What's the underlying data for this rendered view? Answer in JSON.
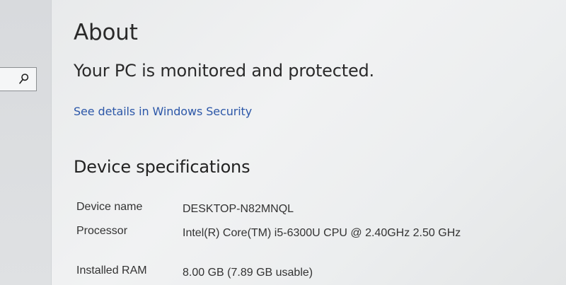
{
  "page": {
    "title": "About",
    "protection_status": "Your PC is monitored and protected.",
    "security_link": "See details in Windows Security"
  },
  "device_specifications": {
    "heading": "Device specifications",
    "rows": [
      {
        "label": "Device name",
        "value": "DESKTOP-N82MNQL"
      },
      {
        "label": "Processor",
        "value": "Intel(R) Core(TM) i5-6300U CPU @ 2.40GHz   2.50 GHz"
      },
      {
        "label": "Installed RAM",
        "value": "8.00 GB (7.89 GB usable)"
      }
    ]
  },
  "icons": {
    "search": "search-icon"
  },
  "colors": {
    "link": "#2c57a8",
    "text": "#2a2a2a",
    "background": "#eeeff0"
  }
}
